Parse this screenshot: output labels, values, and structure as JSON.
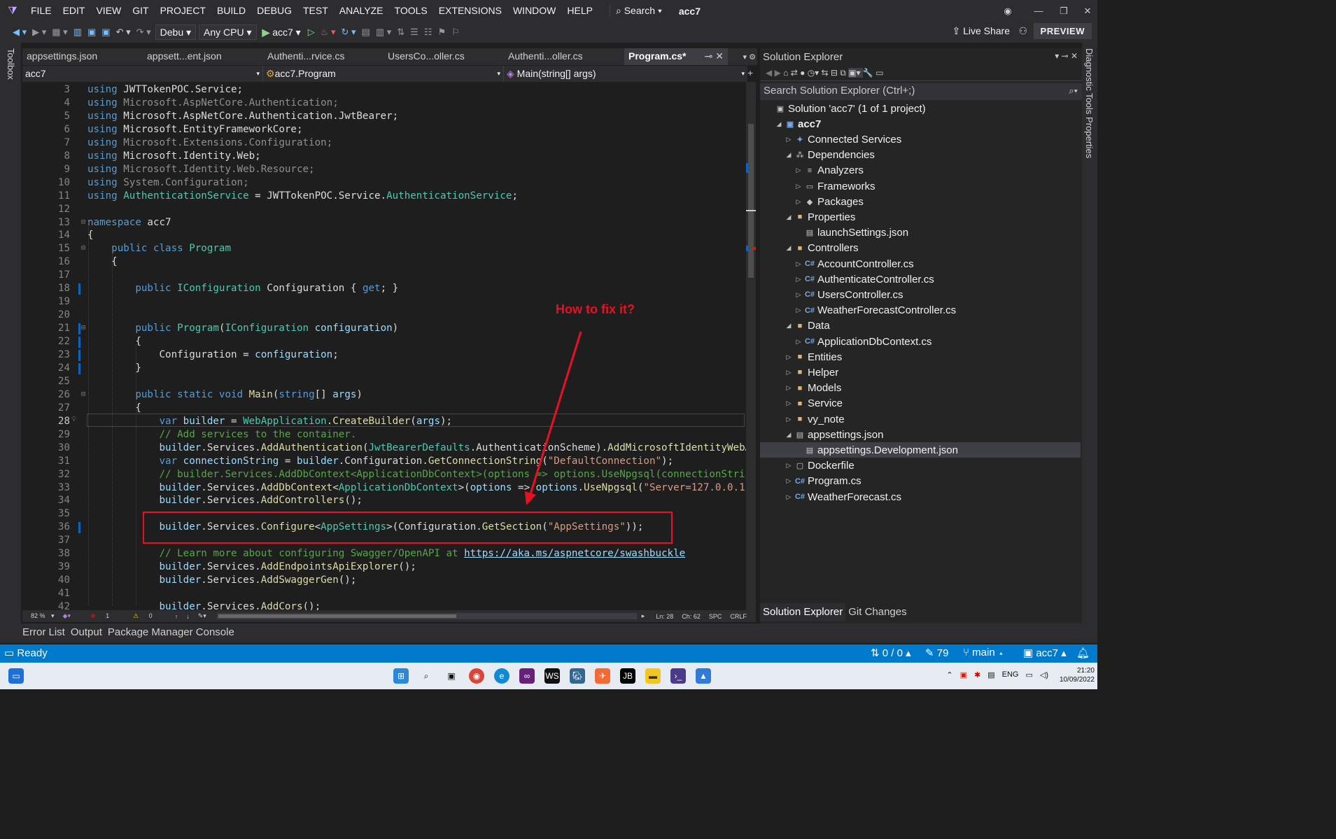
{
  "menu": {
    "items": [
      "FILE",
      "EDIT",
      "VIEW",
      "GIT",
      "PROJECT",
      "BUILD",
      "DEBUG",
      "TEST",
      "ANALYZE",
      "TOOLS",
      "EXTENSIONS",
      "WINDOW",
      "HELP"
    ],
    "search": "Search",
    "project": "acc7"
  },
  "toolbar": {
    "config": "Debu",
    "platform": "Any CPU",
    "run": "acc7",
    "live_share": "Live Share",
    "preview": "PREVIEW"
  },
  "left_strip": "Toolbox",
  "right_strip": "Diagnostic Tools   Properties",
  "tabs": [
    "appsettings.json",
    "appsett...ent.json",
    "Authenti...rvice.cs",
    "UsersCo...oller.cs",
    "Authenti...oller.cs",
    "Program.cs*"
  ],
  "navbar": {
    "project": "acc7",
    "class": "acc7.Program",
    "member": "Main(string[] args)"
  },
  "code": [
    {
      "n": "3",
      "t": [
        [
          "kw",
          "using "
        ],
        [
          "",
          "JWTTokenPOC.Service;"
        ]
      ]
    },
    {
      "n": "4",
      "t": [
        [
          "kw",
          "using "
        ],
        [
          "dim",
          "Microsoft.AspNetCore.Authentication;"
        ]
      ]
    },
    {
      "n": "5",
      "t": [
        [
          "kw",
          "using "
        ],
        [
          "",
          "Microsoft.AspNetCore.Authentication.JwtBearer;"
        ]
      ]
    },
    {
      "n": "6",
      "t": [
        [
          "kw",
          "using "
        ],
        [
          "",
          "Microsoft.EntityFrameworkCore;"
        ]
      ]
    },
    {
      "n": "7",
      "t": [
        [
          "kw",
          "using "
        ],
        [
          "dim",
          "Microsoft.Extensions.Configuration;"
        ]
      ]
    },
    {
      "n": "8",
      "t": [
        [
          "kw",
          "using "
        ],
        [
          "",
          "Microsoft.Identity.Web;"
        ]
      ]
    },
    {
      "n": "9",
      "t": [
        [
          "kw",
          "using "
        ],
        [
          "dim",
          "Microsoft.Identity.Web.Resource;"
        ]
      ]
    },
    {
      "n": "10",
      "t": [
        [
          "kw",
          "using "
        ],
        [
          "dim",
          "System.Configuration;"
        ]
      ]
    },
    {
      "n": "11",
      "t": [
        [
          "kw",
          "using "
        ],
        [
          "ty",
          "AuthenticationService"
        ],
        [
          "",
          " = JWTTokenPOC.Service."
        ],
        [
          "ty",
          "AuthenticationService"
        ],
        [
          "",
          ";"
        ]
      ]
    },
    {
      "n": "12",
      "t": []
    },
    {
      "n": "13",
      "t": [
        [
          "kw",
          "namespace "
        ],
        [
          "",
          "acc7"
        ]
      ]
    },
    {
      "n": "14",
      "t": [
        [
          "",
          "{"
        ]
      ]
    },
    {
      "n": "15",
      "t": [
        [
          "",
          "    "
        ],
        [
          "kw",
          "public class "
        ],
        [
          "ty",
          "Program"
        ]
      ]
    },
    {
      "n": "16",
      "t": [
        [
          "",
          "    {"
        ]
      ]
    },
    {
      "n": "17",
      "t": []
    },
    {
      "n": "18",
      "t": [
        [
          "",
          "        "
        ],
        [
          "kw",
          "public "
        ],
        [
          "ty",
          "IConfiguration"
        ],
        [
          "",
          " Configuration { "
        ],
        [
          "kw",
          "get"
        ],
        [
          "",
          "; }"
        ]
      ]
    },
    {
      "n": "19",
      "t": []
    },
    {
      "n": "20",
      "t": []
    },
    {
      "n": "21",
      "t": [
        [
          "",
          "        "
        ],
        [
          "kw",
          "public "
        ],
        [
          "ty",
          "Program"
        ],
        [
          "",
          "("
        ],
        [
          "ty",
          "IConfiguration"
        ],
        [
          "",
          " "
        ],
        [
          "pm",
          "configuration"
        ],
        [
          "",
          ")"
        ]
      ]
    },
    {
      "n": "22",
      "t": [
        [
          "",
          "        {"
        ]
      ]
    },
    {
      "n": "23",
      "t": [
        [
          "",
          "            Configuration = "
        ],
        [
          "pm",
          "configuration"
        ],
        [
          "",
          ";"
        ]
      ]
    },
    {
      "n": "24",
      "t": [
        [
          "",
          "        }"
        ]
      ]
    },
    {
      "n": "25",
      "t": []
    },
    {
      "n": "26",
      "t": [
        [
          "",
          "        "
        ],
        [
          "kw",
          "public static void "
        ],
        [
          "fn",
          "Main"
        ],
        [
          "",
          "("
        ],
        [
          "kw",
          "string"
        ],
        [
          "",
          "[] "
        ],
        [
          "pm",
          "args"
        ],
        [
          "",
          ")"
        ]
      ]
    },
    {
      "n": "27",
      "t": [
        [
          "",
          "        {"
        ]
      ]
    },
    {
      "n": "28",
      "t": [
        [
          "",
          "            "
        ],
        [
          "kw",
          "var "
        ],
        [
          "pm",
          "builder"
        ],
        [
          "",
          " = "
        ],
        [
          "ty",
          "WebApplication"
        ],
        [
          "",
          "."
        ],
        [
          "fn",
          "CreateBuilder"
        ],
        [
          "",
          "("
        ],
        [
          "pm",
          "args"
        ],
        [
          "",
          ");"
        ]
      ]
    },
    {
      "n": "29",
      "t": [
        [
          "",
          "            "
        ],
        [
          "cm",
          "// Add services to the container."
        ]
      ]
    },
    {
      "n": "30",
      "t": [
        [
          "",
          "            "
        ],
        [
          "pm",
          "builder"
        ],
        [
          "",
          ".Services."
        ],
        [
          "fn",
          "AddAuthentication"
        ],
        [
          "",
          "("
        ],
        [
          "ty",
          "JwtBearerDefaults"
        ],
        [
          "",
          ".AuthenticationScheme)."
        ],
        [
          "fn",
          "AddMicrosoftIdentityWebA"
        ]
      ]
    },
    {
      "n": "31",
      "t": [
        [
          "",
          "            "
        ],
        [
          "kw",
          "var "
        ],
        [
          "pm",
          "connectionString"
        ],
        [
          "",
          " = "
        ],
        [
          "pm",
          "builder"
        ],
        [
          "",
          ".Configuration."
        ],
        [
          "fn",
          "GetConnectionString"
        ],
        [
          "",
          "("
        ],
        [
          "str",
          "\"DefaultConnection\""
        ],
        [
          "",
          ");"
        ]
      ]
    },
    {
      "n": "32",
      "t": [
        [
          "",
          "            "
        ],
        [
          "cm",
          "// builder.Services.AddDbContext<ApplicationDbContext>(options => options.UseNpgsql(connectionStrin"
        ]
      ]
    },
    {
      "n": "33",
      "t": [
        [
          "",
          "            "
        ],
        [
          "pm",
          "builder"
        ],
        [
          "",
          ".Services."
        ],
        [
          "fn",
          "AddDbContext"
        ],
        [
          "",
          "<"
        ],
        [
          "ty",
          "ApplicationDbContext"
        ],
        [
          "",
          ">("
        ],
        [
          "pm",
          "options"
        ],
        [
          "",
          " => "
        ],
        [
          "pm",
          "options"
        ],
        [
          "",
          "."
        ],
        [
          "fn",
          "UseNpgsql"
        ],
        [
          "",
          "("
        ],
        [
          "str",
          "\"Server=127.0.0.1"
        ]
      ]
    },
    {
      "n": "34",
      "t": [
        [
          "",
          "            "
        ],
        [
          "pm",
          "builder"
        ],
        [
          "",
          ".Services."
        ],
        [
          "fn",
          "AddControllers"
        ],
        [
          "",
          "();"
        ]
      ]
    },
    {
      "n": "35",
      "t": []
    },
    {
      "n": "36",
      "t": [
        [
          "",
          "            "
        ],
        [
          "pm",
          "builder"
        ],
        [
          "",
          ".Services."
        ],
        [
          "fn",
          "Configure"
        ],
        [
          "",
          "<"
        ],
        [
          "ty",
          "AppSettings"
        ],
        [
          "",
          ">(Configuration."
        ],
        [
          "fn",
          "GetSection"
        ],
        [
          "",
          "("
        ],
        [
          "str",
          "\"AppSettings\""
        ],
        [
          "",
          "));"
        ]
      ]
    },
    {
      "n": "37",
      "t": []
    },
    {
      "n": "38",
      "t": [
        [
          "",
          "            "
        ],
        [
          "cm",
          "// Learn more about configuring Swagger/OpenAPI at "
        ],
        [
          "lnk",
          "https://aka.ms/aspnetcore/swashbuckle"
        ]
      ]
    },
    {
      "n": "39",
      "t": [
        [
          "",
          "            "
        ],
        [
          "pm",
          "builder"
        ],
        [
          "",
          ".Services."
        ],
        [
          "fn",
          "AddEndpointsApiExplorer"
        ],
        [
          "",
          "();"
        ]
      ]
    },
    {
      "n": "40",
      "t": [
        [
          "",
          "            "
        ],
        [
          "pm",
          "builder"
        ],
        [
          "",
          ".Services."
        ],
        [
          "fn",
          "AddSwaggerGen"
        ],
        [
          "",
          "();"
        ]
      ]
    },
    {
      "n": "41",
      "t": []
    },
    {
      "n": "42",
      "t": [
        [
          "",
          "            "
        ],
        [
          "pm",
          "builder"
        ],
        [
          "",
          ".Services."
        ],
        [
          "fn",
          "AddCors"
        ],
        [
          "",
          "();"
        ]
      ]
    }
  ],
  "editor_status": {
    "zoom": "82 %",
    "errors": "1",
    "warnings": "0",
    "ln": "Ln: 28",
    "ch": "Ch: 62",
    "spc": "SPC",
    "crlf": "CRLF"
  },
  "annotation": {
    "text": "How to fix it?"
  },
  "solution_explorer": {
    "title": "Solution Explorer",
    "search": "Search Solution Explorer (Ctrl+;)",
    "nodes": [
      {
        "label": "Solution 'acc7' (1 of 1 project)",
        "lvl": 0,
        "ar": "",
        "ic": "▣",
        "cls": "json-ic"
      },
      {
        "label": "acc7",
        "lvl": 1,
        "ar": "◢",
        "ic": "▣",
        "cls": "cs-ic",
        "bold": true
      },
      {
        "label": "Connected Services",
        "lvl": 2,
        "ar": "▷",
        "ic": "✦",
        "cls": "cs-ic"
      },
      {
        "label": "Dependencies",
        "lvl": 2,
        "ar": "◢",
        "ic": "⁂",
        "cls": "json-ic"
      },
      {
        "label": "Analyzers",
        "lvl": 3,
        "ar": "▷",
        "ic": "≡",
        "cls": "json-ic"
      },
      {
        "label": "Frameworks",
        "lvl": 3,
        "ar": "▷",
        "ic": "▭",
        "cls": "json-ic"
      },
      {
        "label": "Packages",
        "lvl": 3,
        "ar": "▷",
        "ic": "◆",
        "cls": "json-ic"
      },
      {
        "label": "Properties",
        "lvl": 2,
        "ar": "◢",
        "ic": "■",
        "cls": "fold-ic"
      },
      {
        "label": "launchSettings.json",
        "lvl": 3,
        "ar": "",
        "ic": "▤",
        "cls": "json-ic"
      },
      {
        "label": "Controllers",
        "lvl": 2,
        "ar": "◢",
        "ic": "■",
        "cls": "fold-ic"
      },
      {
        "label": "AccountController.cs",
        "lvl": 3,
        "ar": "▷",
        "ic": "C#",
        "cls": "cs-ic"
      },
      {
        "label": "AuthenticateController.cs",
        "lvl": 3,
        "ar": "▷",
        "ic": "C#",
        "cls": "cs-ic"
      },
      {
        "label": "UsersController.cs",
        "lvl": 3,
        "ar": "▷",
        "ic": "C#",
        "cls": "cs-ic"
      },
      {
        "label": "WeatherForecastController.cs",
        "lvl": 3,
        "ar": "▷",
        "ic": "C#",
        "cls": "cs-ic"
      },
      {
        "label": "Data",
        "lvl": 2,
        "ar": "◢",
        "ic": "■",
        "cls": "fold-ic"
      },
      {
        "label": "ApplicationDbContext.cs",
        "lvl": 3,
        "ar": "▷",
        "ic": "C#",
        "cls": "cs-ic"
      },
      {
        "label": "Entities",
        "lvl": 2,
        "ar": "▷",
        "ic": "■",
        "cls": "fold-ic"
      },
      {
        "label": "Helper",
        "lvl": 2,
        "ar": "▷",
        "ic": "■",
        "cls": "fold-ic"
      },
      {
        "label": "Models",
        "lvl": 2,
        "ar": "▷",
        "ic": "■",
        "cls": "fold-ic"
      },
      {
        "label": "Service",
        "lvl": 2,
        "ar": "▷",
        "ic": "■",
        "cls": "fold-ic"
      },
      {
        "label": "vy_note",
        "lvl": 2,
        "ar": "▷",
        "ic": "■",
        "cls": "fold-ic"
      },
      {
        "label": "appsettings.json",
        "lvl": 2,
        "ar": "◢",
        "ic": "▤",
        "cls": "json-ic"
      },
      {
        "label": "appsettings.Development.json",
        "lvl": 3,
        "ar": "",
        "ic": "▤",
        "cls": "json-ic",
        "sel": true
      },
      {
        "label": "Dockerfile",
        "lvl": 2,
        "ar": "▷",
        "ic": "▢",
        "cls": "json-ic"
      },
      {
        "label": "Program.cs",
        "lvl": 2,
        "ar": "▷",
        "ic": "C#",
        "cls": "cs-ic"
      },
      {
        "label": "WeatherForecast.cs",
        "lvl": 2,
        "ar": "▷",
        "ic": "C#",
        "cls": "cs-ic"
      }
    ],
    "bottom_tabs": [
      "Solution Explorer",
      "Git Changes"
    ]
  },
  "bottom_tabs": [
    "Error List",
    "Output",
    "Package Manager Console"
  ],
  "status": {
    "ready": "Ready",
    "sync": "0 / 0",
    "edits": "79",
    "branch": "main",
    "project": "acc7",
    "notif": "1"
  },
  "taskbar": {
    "lang": "ENG",
    "time": "21:20",
    "date": "10/09/2022"
  }
}
